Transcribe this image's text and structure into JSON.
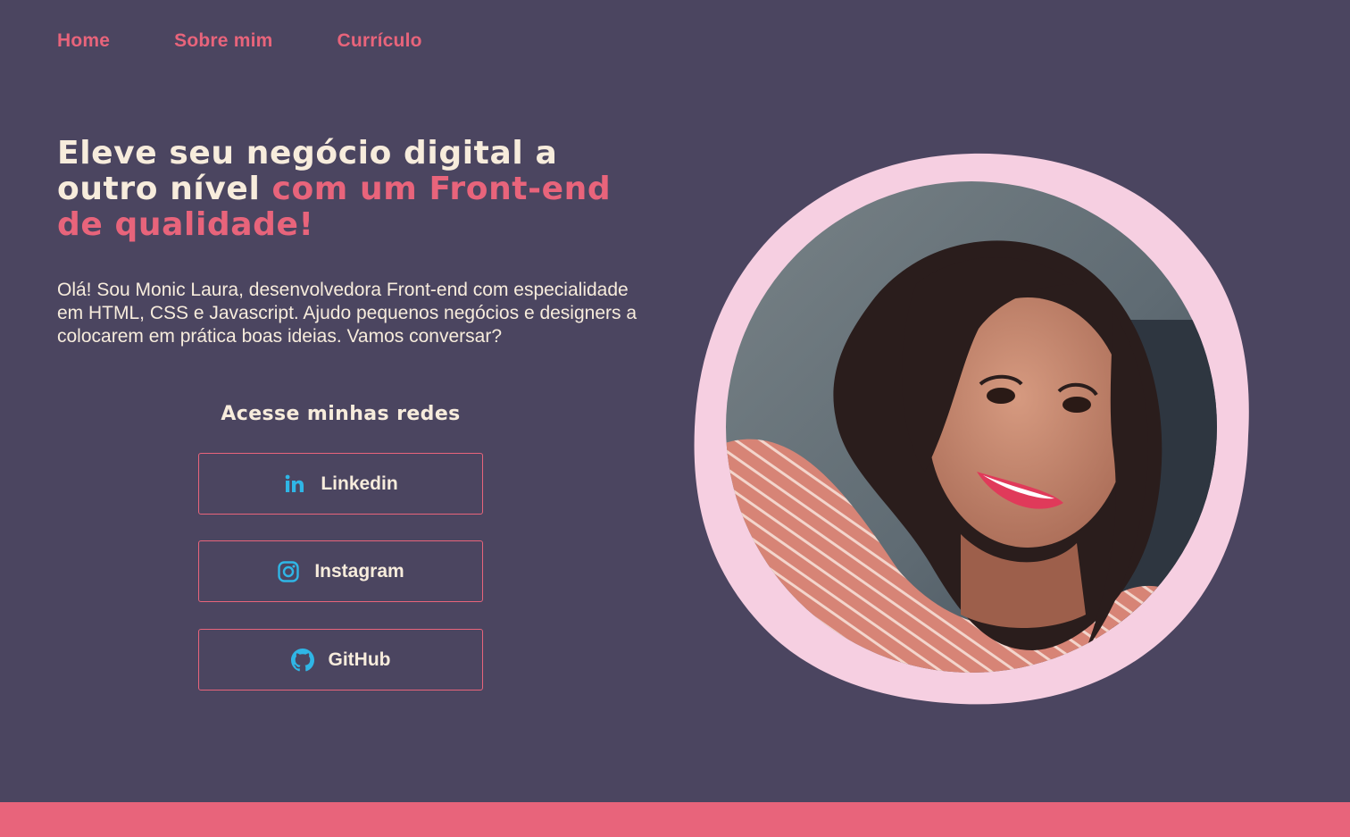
{
  "nav": {
    "items": [
      {
        "label": "Home"
      },
      {
        "label": "Sobre mim"
      },
      {
        "label": "Currículo"
      }
    ]
  },
  "hero": {
    "headline_part1": "Eleve seu negócio digital a outro nível ",
    "headline_accent": "com um Front-end de qualidade!",
    "intro": "Olá! Sou Monic Laura, desenvolvedora Front-end com especialidade em HTML, CSS e Javascript. Ajudo pequenos negócios e designers a colocarem em prática boas ideias. Vamos conversar?"
  },
  "socials": {
    "title": "Acesse minhas redes",
    "buttons": [
      {
        "label": "Linkedin",
        "icon": "linkedin-icon"
      },
      {
        "label": "Instagram",
        "icon": "instagram-icon"
      },
      {
        "label": "GitHub",
        "icon": "github-icon"
      }
    ]
  },
  "photo": {
    "icon": "profile-photo"
  },
  "colors": {
    "background": "#4b4560",
    "accent": "#e8647b",
    "text": "#f7ecdc",
    "icon": "#2fb6e6",
    "photo_frame": "#f6cfe1"
  }
}
